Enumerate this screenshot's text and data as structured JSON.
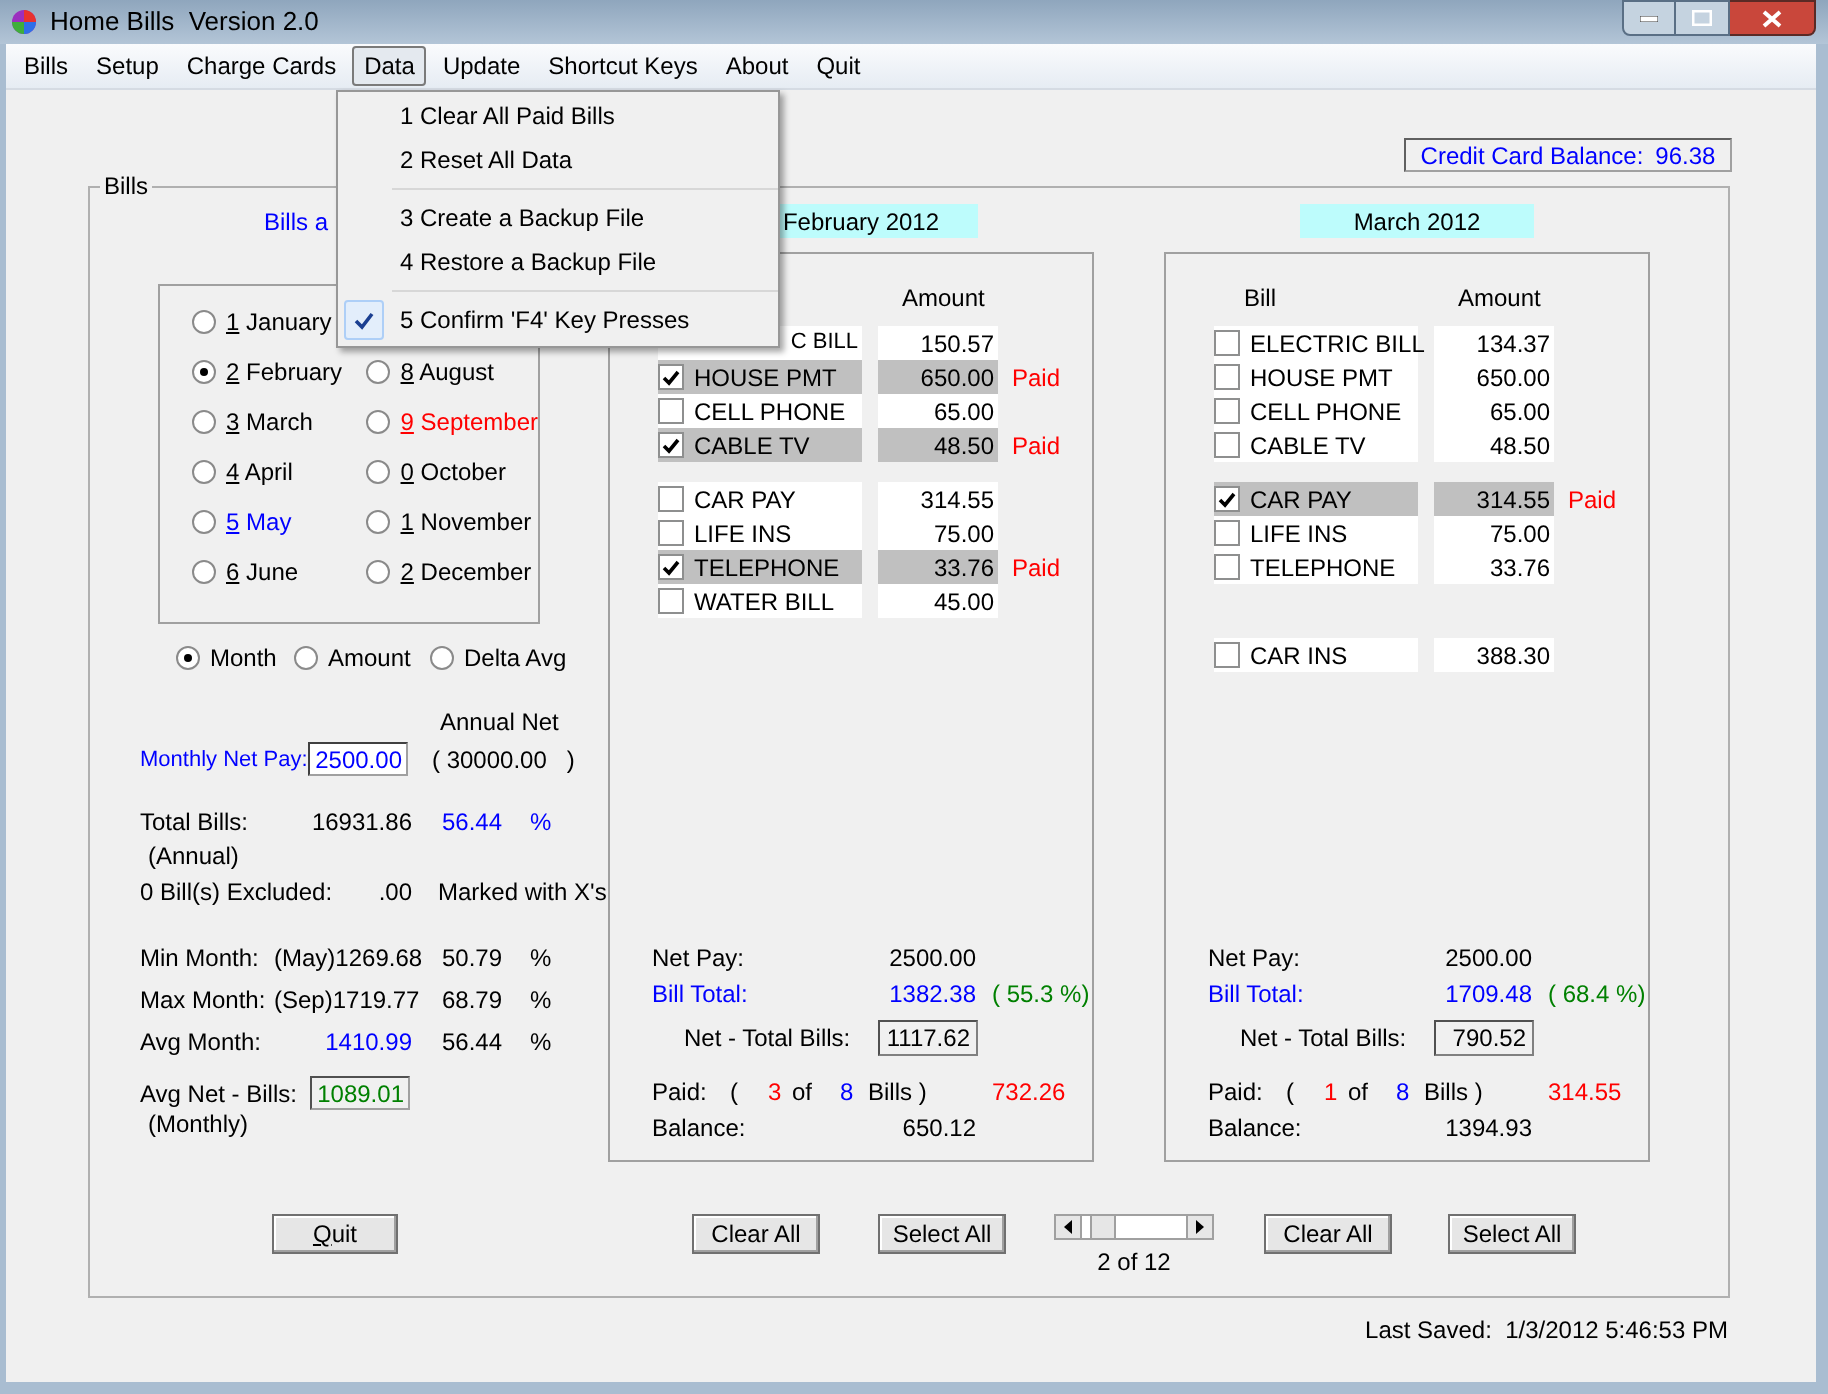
{
  "window": {
    "title": "Home Bills  Version 2.0"
  },
  "menu_bar": [
    {
      "label": "Bills",
      "selected": false
    },
    {
      "label": "Setup",
      "selected": false
    },
    {
      "label": "Charge Cards",
      "selected": false
    },
    {
      "label": "Data",
      "selected": true
    },
    {
      "label": "Update",
      "selected": false
    },
    {
      "label": "Shortcut Keys",
      "selected": false
    },
    {
      "label": "About",
      "selected": false
    },
    {
      "label": "Quit",
      "selected": false
    }
  ],
  "data_menu": {
    "groups": [
      {
        "items": [
          {
            "label": "1 Clear All Paid Bills",
            "checked": false
          },
          {
            "label": "2 Reset All Data",
            "checked": false
          }
        ]
      },
      {
        "items": [
          {
            "label": "3 Create a Backup File",
            "checked": false
          },
          {
            "label": "4 Restore a Backup File",
            "checked": false
          }
        ]
      },
      {
        "items": [
          {
            "label": "5 Confirm 'F4' Key Presses",
            "checked": true
          }
        ]
      }
    ]
  },
  "credit_card_balance": {
    "label": "Credit Card Balance:",
    "value": "96.38"
  },
  "bills": {
    "title": "Bills",
    "caption": "Bills a",
    "month_columns": [
      {
        "months": [
          {
            "label": "1 January",
            "selected": false,
            "color": "#000000"
          },
          {
            "label": "2 February",
            "selected": true,
            "color": "#000000"
          },
          {
            "label": "3 March",
            "selected": false,
            "color": "#000000"
          },
          {
            "label": "4 April",
            "selected": false,
            "color": "#000000"
          },
          {
            "label": "5 May",
            "selected": false,
            "color": "#0000ff"
          },
          {
            "label": "6 June",
            "selected": false,
            "color": "#000000"
          }
        ]
      },
      {
        "months": [
          {
            "label": "8 August",
            "selected": false,
            "color": "#000000"
          },
          {
            "label": "9 September",
            "selected": false,
            "color": "#ff0000"
          },
          {
            "label": "0 October",
            "selected": false,
            "color": "#000000"
          },
          {
            "label": "1 November",
            "selected": false,
            "color": "#000000"
          },
          {
            "label": "2 December",
            "selected": false,
            "color": "#000000"
          }
        ]
      }
    ],
    "sort_options": [
      {
        "label": "Month",
        "selected": true
      },
      {
        "label": "Amount",
        "selected": false
      },
      {
        "label": "Delta Avg",
        "selected": false
      }
    ],
    "annual_net_label": "Annual Net",
    "monthly_net_pay": {
      "label": "Monthly Net Pay:",
      "value": "2500.00",
      "annual": "( 30000.00   )"
    },
    "total_bills": {
      "label": "Total Bills:",
      "value": "16931.86",
      "percent": "56.44",
      "unit": "%",
      "note": "(Annual)"
    },
    "excluded": {
      "label": "0 Bill(s) Excluded:",
      "value": ".00",
      "note": "Marked with X's"
    },
    "month_stats": [
      {
        "label": "Min Month:",
        "month": "(May)",
        "value": "1269.68",
        "percent": "50.79",
        "unit": "%",
        "highlight": false
      },
      {
        "label": "Max Month:",
        "month": "(Sep)",
        "value": "1719.77",
        "percent": "68.79",
        "unit": "%",
        "highlight": false
      },
      {
        "label": "Avg Month:",
        "value": "1410.99",
        "percent": "56.44",
        "unit": "%",
        "highlight": true
      }
    ],
    "avg_net": {
      "label": "Avg Net - Bills:",
      "value": "1089.01",
      "note": "(Monthly)"
    },
    "quit_button": "Quit",
    "panels": [
      {
        "header": "February 2012",
        "headings": {
          "amount": "Amount"
        },
        "groups": [
          {
            "bills": [
              {
                "kind": "cut",
                "name": "C BILL",
                "amount": "150.57"
              },
              {
                "kind": "bill",
                "name": "HOUSE PMT",
                "amount": "650.00",
                "checked": true,
                "status": "Paid"
              },
              {
                "kind": "bill",
                "name": "CELL PHONE",
                "amount": "65.00",
                "checked": false
              },
              {
                "kind": "bill",
                "name": "CABLE TV",
                "amount": "48.50",
                "checked": true,
                "status": "Paid"
              }
            ]
          },
          {
            "bills": [
              {
                "kind": "bill",
                "name": "CAR PAY",
                "amount": "314.55",
                "checked": false
              },
              {
                "kind": "bill",
                "name": "LIFE INS",
                "amount": "75.00",
                "checked": false
              },
              {
                "kind": "bill",
                "name": "TELEPHONE",
                "amount": "33.76",
                "checked": true,
                "status": "Paid"
              },
              {
                "kind": "bill",
                "name": "WATER BILL",
                "amount": "45.00",
                "checked": false
              }
            ]
          }
        ],
        "net_pay": {
          "label": "Net Pay:",
          "value": "2500.00"
        },
        "bill_total": {
          "label": "Bill Total:",
          "value": "1382.38",
          "percent": "( 55.3 %)"
        },
        "net_total": {
          "label": "Net - Total Bills:",
          "value": "1117.62"
        },
        "paid": {
          "label": "Paid:",
          "open": "(",
          "count": "3",
          "of": "of",
          "total": "8",
          "close": "Bills )",
          "amount": "732.26"
        },
        "balance": {
          "label": "Balance:",
          "value": "650.12"
        },
        "buttons": [
          "Clear All",
          "Select All"
        ]
      },
      {
        "header": "March 2012",
        "headings": {
          "bill": "Bill",
          "amount": "Amount"
        },
        "groups": [
          {
            "bills": [
              {
                "kind": "bill",
                "name": "ELECTRIC BILL",
                "amount": "134.37",
                "checked": false
              },
              {
                "kind": "bill",
                "name": "HOUSE PMT",
                "amount": "650.00",
                "checked": false
              },
              {
                "kind": "bill",
                "name": "CELL PHONE",
                "amount": "65.00",
                "checked": false
              },
              {
                "kind": "bill",
                "name": "CABLE TV",
                "amount": "48.50",
                "checked": false
              }
            ]
          },
          {
            "bills": [
              {
                "kind": "bill",
                "name": "CAR PAY",
                "amount": "314.55",
                "checked": true,
                "status": "Paid"
              },
              {
                "kind": "bill",
                "name": "LIFE INS",
                "amount": "75.00",
                "checked": false
              },
              {
                "kind": "bill",
                "name": "TELEPHONE",
                "amount": "33.76",
                "checked": false
              }
            ]
          },
          {
            "bills": [
              {
                "kind": "bill",
                "name": "CAR INS",
                "amount": "388.30",
                "checked": false
              }
            ]
          }
        ],
        "net_pay": {
          "label": "Net Pay:",
          "value": "2500.00"
        },
        "bill_total": {
          "label": "Bill Total:",
          "value": "1709.48",
          "percent": "( 68.4 %)"
        },
        "net_total": {
          "label": "Net - Total Bills:",
          "value": "790.52"
        },
        "paid": {
          "label": "Paid:",
          "open": "(",
          "count": "1",
          "of": "of",
          "total": "8",
          "close": "Bills )",
          "amount": "314.55"
        },
        "balance": {
          "label": "Balance:",
          "value": "1394.93"
        },
        "buttons": [
          "Clear All",
          "Select All"
        ]
      }
    ],
    "pager": {
      "label": "2 of 12"
    }
  },
  "status": {
    "last_saved": "Last Saved:  1/3/2012 5:46:53 PM"
  }
}
